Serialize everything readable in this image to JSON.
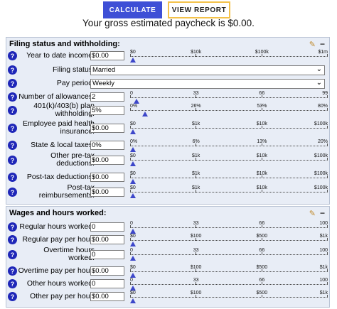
{
  "buttons": {
    "calculate": "CALCULATE",
    "view_report": "VIEW REPORT"
  },
  "summary": "Your gross estimated paycheck is $0.00.",
  "accent": "#3e4fd6",
  "filing": {
    "title": "Filing status and withholding:",
    "rows": [
      {
        "label": "Year to date income:",
        "value": "$0.00",
        "ticks": [
          "$0",
          "$10k",
          "$100k",
          "$1m"
        ],
        "level": 0
      },
      {
        "label": "Filing status:",
        "select": "Married"
      },
      {
        "label": "Pay period:",
        "select": "Weekly"
      },
      {
        "label": "Number of allowances:",
        "value": "2",
        "ticks": [
          "0",
          "33",
          "66",
          "99"
        ],
        "level": 0.02
      },
      {
        "label": "401(k)/403(b) plan withholding:",
        "value": "5%",
        "ticks": [
          "0%",
          "26%",
          "53%",
          "80%"
        ],
        "level": 0.0625
      },
      {
        "label": "Employee paid health insurance:",
        "value": "$0.00",
        "ticks": [
          "$0",
          "$1k",
          "$10k",
          "$100k"
        ],
        "level": 0
      },
      {
        "label": "State & local taxes:",
        "value": "0%",
        "ticks": [
          "0%",
          "6%",
          "13%",
          "20%"
        ],
        "level": 0
      },
      {
        "label": "Other pre-tax deductions:",
        "value": "$0.00",
        "ticks": [
          "$0",
          "$1k",
          "$10k",
          "$100k"
        ],
        "level": 0
      },
      {
        "label": "Post-tax deductions:",
        "value": "$0.00",
        "ticks": [
          "$0",
          "$1k",
          "$10k",
          "$100k"
        ],
        "level": 0
      },
      {
        "label": "Post-tax reimbursements:",
        "value": "$0.00",
        "ticks": [
          "$0",
          "$1k",
          "$10k",
          "$100k"
        ],
        "level": 0
      }
    ]
  },
  "wages": {
    "title": "Wages and hours worked:",
    "rows": [
      {
        "label": "Regular hours worked:",
        "value": "0",
        "ticks": [
          "0",
          "33",
          "66",
          "100"
        ],
        "level": 0
      },
      {
        "label": "Regular pay per hour:",
        "value": "$0.00",
        "ticks": [
          "$0",
          "$100",
          "$500",
          "$1k"
        ],
        "level": 0
      },
      {
        "label": "Overtime hours worked:",
        "value": "0",
        "ticks": [
          "0",
          "33",
          "66",
          "100"
        ],
        "level": 0
      },
      {
        "label": "Overtime pay per hour:",
        "value": "$0.00",
        "ticks": [
          "$0",
          "$100",
          "$500",
          "$1k"
        ],
        "level": 0
      },
      {
        "label": "Other hours worked:",
        "value": "0",
        "ticks": [
          "0",
          "33",
          "66",
          "100"
        ],
        "level": 0
      },
      {
        "label": "Other pay per hour:",
        "value": "$0.00",
        "ticks": [
          "$0",
          "$100",
          "$500",
          "$1k"
        ],
        "level": 0
      }
    ]
  }
}
